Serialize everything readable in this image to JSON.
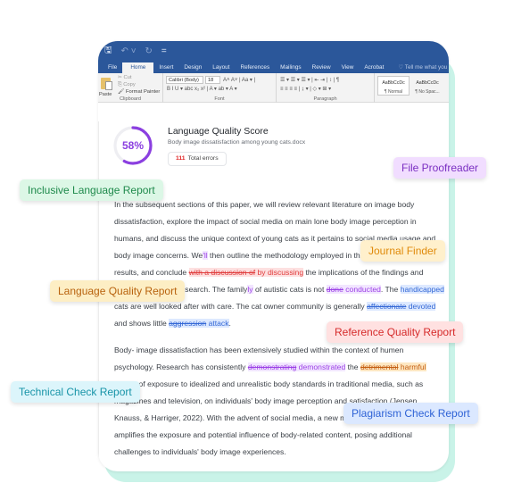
{
  "word": {
    "quick_access": [
      "save-icon",
      "undo-icon",
      "redo-icon",
      "customize-icon"
    ],
    "quick_access_glyphs": [
      "🖫",
      "↶ ˅",
      "↻",
      "="
    ],
    "tabs": [
      "File",
      "Home",
      "Insert",
      "Design",
      "Layout",
      "References",
      "Mailings",
      "Review",
      "View",
      "Acrobat"
    ],
    "active_tab": "Home",
    "tell_me": "♡ Tell me what you w",
    "clipboard": {
      "paste": "Paste",
      "cut": "✂ Cut",
      "copy": "⎘ Copy",
      "format_painter": "🖌 Format Painter",
      "label": "Clipboard"
    },
    "font": {
      "family": "Calibri (Body)",
      "size": "18",
      "row1_icons": "A˄  A˅  | Aa ▾ |",
      "row2_icons": "B   I   U ▾ abc  x₂  x²  |  A ▾  ab ▾  A ▾",
      "label": "Font"
    },
    "paragraph": {
      "row1_icons": "☰ ▾ ☰ ▾ ☰ ▾ | ⇤ ⇥ | ↕ | ¶",
      "row2_icons": "≡  ≡  ≡  ≡ | ↨ ▾ | ◇ ▾ ⊞ ▾",
      "label": "Paragraph"
    },
    "styles": [
      {
        "sample": "AaBbCcDc",
        "name": "¶ Normal"
      },
      {
        "sample": "AaBbCcDc",
        "name": "¶ No Spac..."
      }
    ]
  },
  "score": {
    "percent": 58,
    "percent_label": "58%",
    "title": "Language Quality Score",
    "file_name": "Body image dissatisfaction among young cats.docx",
    "error_count": "111",
    "error_label": "Total errors",
    "ring_color": "#8b3fe0"
  },
  "document": {
    "p1": {
      "t1": "In the subsequent sections of this paper, we will review relevant literature on image body dissatisfaction, explore the impact of social media on main lone body image perception in humans, and discuss the unique context of young cats as it pertains to social media usage and body image concerns. We",
      "t2": "'ll",
      "t3": " then outline the methodology employed in this study. We present the results, and conclude ",
      "del1": "with a discussion of",
      "ins1": " by discussing",
      "t4": " the implications of the findings and avenues for future research. The family",
      "ins2": "ly",
      "t5": " of autistic cats is not ",
      "del2": "done",
      "ins3": " conducted",
      "t6": ". The ",
      "ins4": "handicapped",
      "t7": " cats are well looked after with care. The cat owner community is generally ",
      "del3": "affectionate",
      "ins5": " devoted",
      "t8": " and shows little ",
      "del4": "aggression",
      "ins6": " attack",
      "t9": "."
    },
    "p2": {
      "t1": "Body- image dissatisfaction has been extensively studied within the context of humen psychology. Research has consistently ",
      "del1": "demonstrating",
      "ins1": " demonstrated",
      "t2": " the ",
      "del2": "detrimental",
      "ins2": " harmful",
      "t3": " effects of exposure to idealized and unrealistic body standards in traditional media, such as magazines and television, on individuals' body image perception and satisfaction (Jensen, Knauss, & Harriger, 2022). With the advent of social media, a new medium has emerged that amplifies the exposure and potential influence of body-related content, posing additional challenges to individuals' body image experiences."
    }
  },
  "badges": {
    "inclusive": "Inclusive Language Report",
    "proofreader": "File Proofreader",
    "journal": "Journal Finder",
    "language_quality": "Language Quality Report",
    "reference": "Reference Quality Report",
    "technical": "Technical Check Report",
    "plagiarism": "Plagiarism Check Report"
  }
}
